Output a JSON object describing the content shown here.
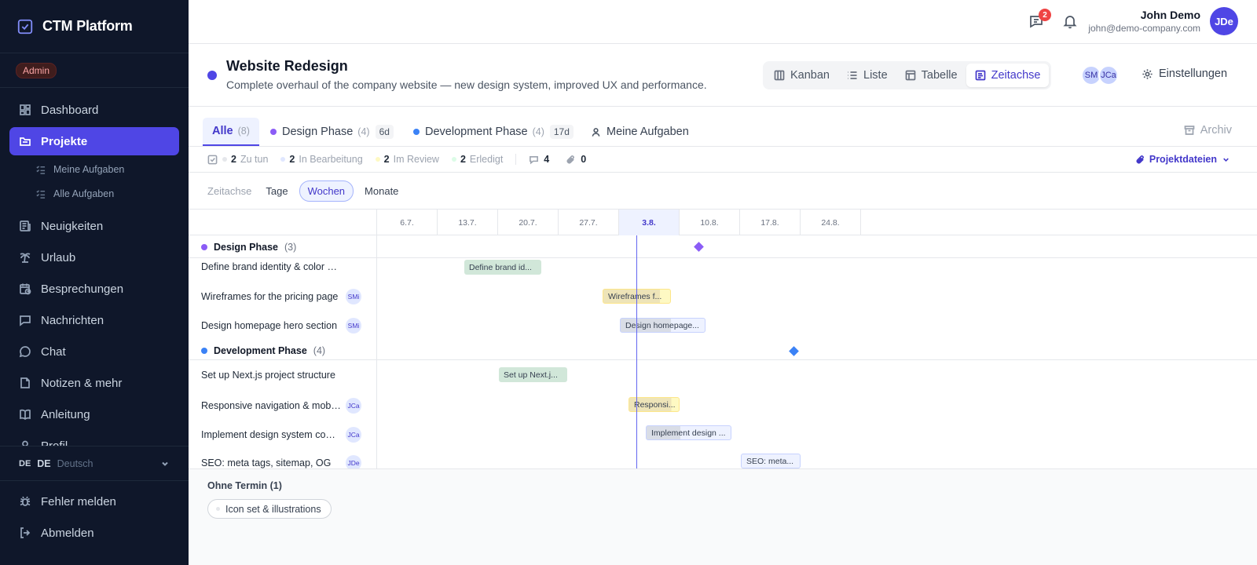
{
  "app": {
    "title": "CTM Platform",
    "role": "Admin"
  },
  "sidebar": {
    "items": [
      {
        "label": "Dashboard",
        "icon": "dashboard-icon"
      },
      {
        "label": "Projekte",
        "icon": "folder-icon",
        "active": true
      },
      {
        "label": "Neuigkeiten",
        "icon": "news-icon"
      },
      {
        "label": "Urlaub",
        "icon": "palm-tree-icon"
      },
      {
        "label": "Besprechungen",
        "icon": "calendar-clock-icon"
      },
      {
        "label": "Nachrichten",
        "icon": "message-icon"
      },
      {
        "label": "Chat",
        "icon": "chat-icon"
      },
      {
        "label": "Notizen & mehr",
        "icon": "note-icon"
      },
      {
        "label": "Anleitung",
        "icon": "book-icon"
      },
      {
        "label": "Profil",
        "icon": "user-icon"
      }
    ],
    "sub_items": [
      {
        "label": "Meine Aufgaben",
        "icon": "list-check-icon"
      },
      {
        "label": "Alle Aufgaben",
        "icon": "list-check-icon"
      }
    ],
    "language": {
      "flag": "DE",
      "code": "DE",
      "name": "Deutsch"
    },
    "bottom": [
      {
        "label": "Fehler melden",
        "icon": "bug-icon"
      },
      {
        "label": "Abmelden",
        "icon": "logout-icon"
      }
    ]
  },
  "topbar": {
    "message_badge": "2",
    "user_name": "John Demo",
    "user_email": "john@demo-company.com",
    "user_initials": "JDe"
  },
  "project": {
    "title": "Website Redesign",
    "description": "Complete overhaul of the company website — new design system, improved UX and performance.",
    "views": [
      "Kanban",
      "Liste",
      "Tabelle",
      "Zeitachse"
    ],
    "active_view": "Zeitachse",
    "members": [
      "SM",
      "JCa"
    ],
    "settings_label": "Einstellungen"
  },
  "tabs": {
    "all": {
      "label": "Alle",
      "count": "(8)"
    },
    "design": {
      "label": "Design Phase",
      "count": "(4)",
      "duration": "6d",
      "color": "#8b5cf6"
    },
    "development": {
      "label": "Development Phase",
      "count": "(4)",
      "duration": "17d",
      "color": "#3b82f6"
    },
    "mine": {
      "label": "Meine Aufgaben"
    },
    "archive": "Archiv"
  },
  "stats": {
    "todo": {
      "count": "2",
      "label": "Zu tun"
    },
    "in_progress": {
      "count": "2",
      "label": "In Bearbeitung"
    },
    "review": {
      "count": "2",
      "label": "Im Review"
    },
    "done": {
      "count": "2",
      "label": "Erledigt"
    },
    "comments": "4",
    "attachments": "0",
    "files_label": "Projektdateien"
  },
  "zoom": {
    "label": "Zeitachse",
    "options": [
      "Tage",
      "Wochen",
      "Monate"
    ],
    "active": "Wochen"
  },
  "timeline": {
    "weeks": [
      "6.7.",
      "13.7.",
      "20.7.",
      "27.7.",
      "3.8.",
      "10.8.",
      "17.8.",
      "24.8."
    ],
    "current_week": "3.8.",
    "groups": [
      {
        "name": "Design Phase",
        "count": "(3)",
        "tasks": [
          {
            "name": "Define brand identity & color palette",
            "bar": "Define brand id...",
            "assignee": ""
          },
          {
            "name": "Wireframes for the pricing page",
            "bar": "Wireframes f...",
            "assignee": "SMi"
          },
          {
            "name": "Design homepage hero section",
            "bar": "Design homepage...",
            "assignee": "SMi"
          }
        ]
      },
      {
        "name": "Development Phase",
        "count": "(4)",
        "tasks": [
          {
            "name": "Set up Next.js project structure",
            "bar": "Set up Next.j...",
            "assignee": ""
          },
          {
            "name": "Responsive navigation & mobile menu",
            "bar": "Responsi...",
            "assignee": "JCa"
          },
          {
            "name": "Implement design system components",
            "bar": "Implement design ...",
            "assignee": "JCa"
          },
          {
            "name": "SEO: meta tags, sitemap, OG",
            "bar": "SEO: meta...",
            "assignee": "JDe"
          }
        ]
      }
    ]
  },
  "no_date": {
    "title": "Ohne Termin (1)",
    "items": [
      "Icon set & illustrations"
    ]
  }
}
